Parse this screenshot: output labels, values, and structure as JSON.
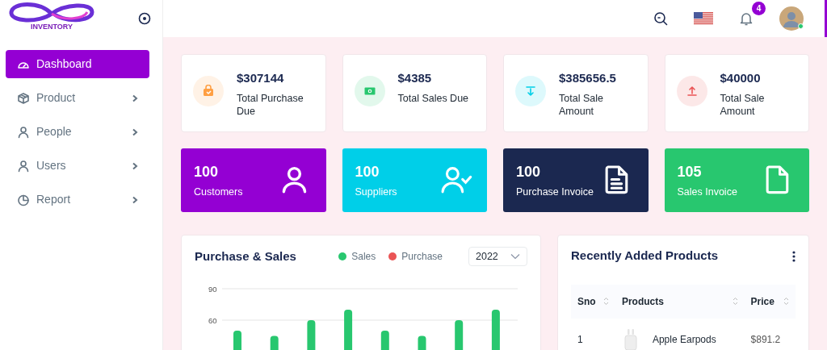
{
  "sidebar": {
    "logo_text": "INVENTORY",
    "items": [
      {
        "label": "Dashboard",
        "selected": true,
        "has_submenu": false
      },
      {
        "label": "Product",
        "selected": false,
        "has_submenu": true
      },
      {
        "label": "People",
        "selected": false,
        "has_submenu": true
      },
      {
        "label": "Users",
        "selected": false,
        "has_submenu": true
      },
      {
        "label": "Report",
        "selected": false,
        "has_submenu": true
      }
    ]
  },
  "header": {
    "notification_count": "4"
  },
  "stat_cards": [
    {
      "value": "$307144",
      "label": "Total Purchase Due",
      "color": "#ff9f43"
    },
    {
      "value": "$4385",
      "label": "Total Sales Due",
      "color": "#28c76f"
    },
    {
      "value": "$385656.5",
      "label": "Total Sale Amount",
      "color": "#00cfe8"
    },
    {
      "value": "$40000",
      "label": "Total Sale Amount",
      "color": "#ea5455"
    }
  ],
  "count_cards": [
    {
      "value": "100",
      "label": "Customers",
      "color": "#9400d3"
    },
    {
      "value": "100",
      "label": "Suppliers",
      "color": "#00cfe8"
    },
    {
      "value": "100",
      "label": "Purchase Invoice",
      "color": "#1b2850"
    },
    {
      "value": "105",
      "label": "Sales Invoice",
      "color": "#28c76f"
    }
  ],
  "sales_chart": {
    "title": "Purchase & Sales",
    "year_select": {
      "value": "2022"
    },
    "chart_data": {
      "type": "bar",
      "ylim": [
        0,
        90
      ],
      "yticks": [
        60,
        90
      ],
      "series": [
        {
          "name": "Sales",
          "color": "#28c76f",
          "values": [
            50,
            45,
            60,
            70,
            50,
            45,
            60,
            70
          ]
        },
        {
          "name": "Purchase",
          "color": "#ea5455",
          "values": [
            null,
            null,
            null,
            null,
            null,
            null,
            null,
            null
          ]
        }
      ]
    }
  },
  "products": {
    "title": "Recently Added Products",
    "columns": [
      "Sno",
      "Products",
      "Price"
    ],
    "rows": [
      {
        "sno": "1",
        "product": "Apple Earpods",
        "price": "$891.2"
      }
    ]
  }
}
